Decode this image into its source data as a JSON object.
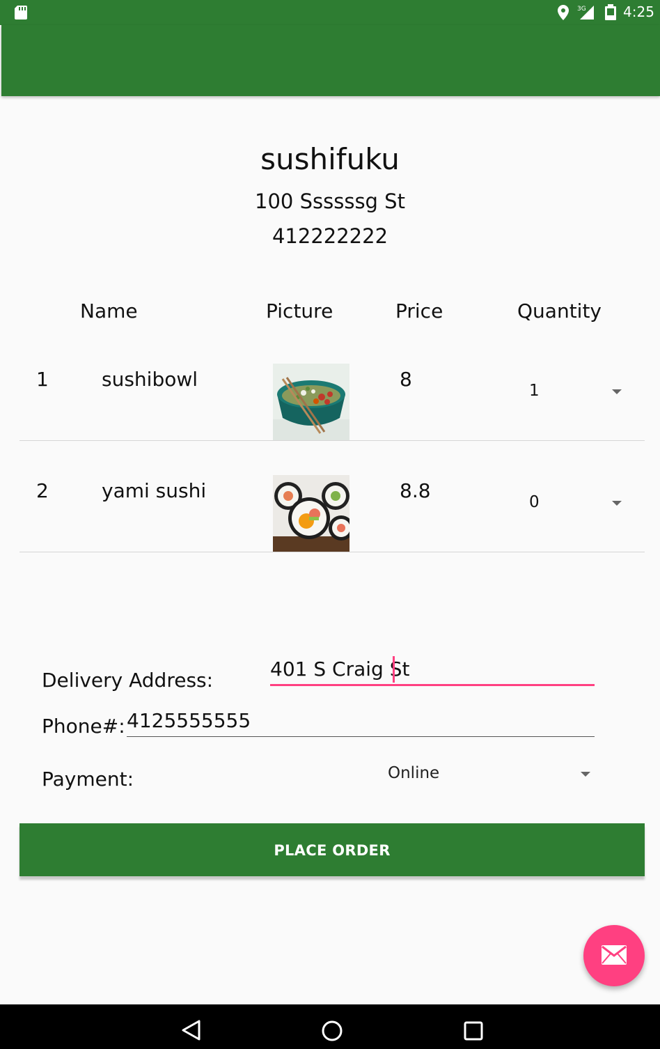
{
  "status_bar": {
    "time": "4:25",
    "network": "3G",
    "icons": [
      "sd-card-icon",
      "location-icon",
      "signal-icon",
      "battery-icon"
    ]
  },
  "restaurant": {
    "name": "sushifuku",
    "address": "100 Ssssssg St",
    "phone": "412222222"
  },
  "table": {
    "headers": [
      "Name",
      "Picture",
      "Price",
      "Quantity"
    ],
    "rows": [
      {
        "index": "1",
        "name": "sushibowl",
        "picture": "sushi-bowl-photo",
        "price": "8",
        "quantity": "1"
      },
      {
        "index": "2",
        "name": "yami sushi",
        "picture": "sushi-roll-photo",
        "price": "8.8",
        "quantity": "0"
      }
    ]
  },
  "form": {
    "address_label": "Delivery Address:",
    "address_value": "401 S Craig St",
    "phone_label": "Phone#:",
    "phone_value": "4125555555",
    "payment_label": "Payment:",
    "payment_value": "Online"
  },
  "actions": {
    "place_order_label": "PLACE ORDER",
    "fab_icon": "email-icon"
  },
  "colors": {
    "primary": "#2e7d32",
    "accent": "#ff4081"
  },
  "nav_bar": {
    "icons": [
      "back-icon",
      "home-icon",
      "recents-icon"
    ]
  }
}
